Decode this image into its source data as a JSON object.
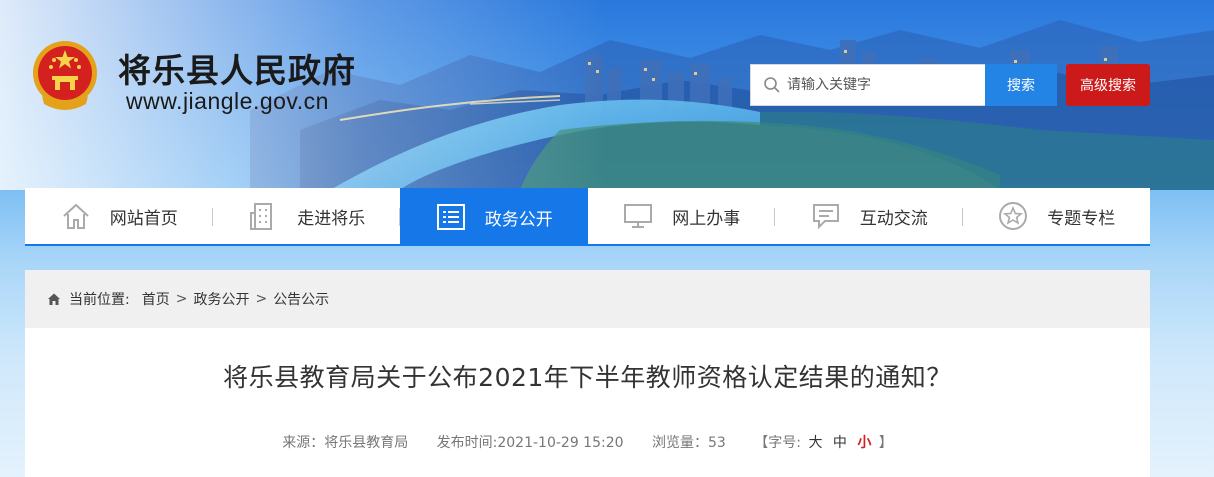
{
  "header": {
    "site_title": "将乐县人民政府",
    "site_url": "www.jiangle.gov.cn",
    "emblem_icon": "national-emblem-icon"
  },
  "search": {
    "placeholder": "请输入关键字",
    "value": "",
    "button_label": "搜索",
    "advanced_label": "高级搜索"
  },
  "nav": {
    "items": [
      {
        "label": "网站首页",
        "icon": "home-icon"
      },
      {
        "label": "走进将乐",
        "icon": "building-icon"
      },
      {
        "label": "政务公开",
        "icon": "list-icon"
      },
      {
        "label": "网上办事",
        "icon": "monitor-icon"
      },
      {
        "label": "互动交流",
        "icon": "chat-icon"
      },
      {
        "label": "专题专栏",
        "icon": "star-icon"
      }
    ]
  },
  "breadcrumb": {
    "prefix": "当前位置:",
    "items": [
      "首页",
      "政务公开",
      "公告公示"
    ],
    "separator": ">"
  },
  "article": {
    "title": "将乐县教育局关于公布2021年下半年教师资格认定结果的通知？",
    "source": "来源：将乐县教育局",
    "published": "发布时间:2021-10-29 15:20",
    "views": "浏览量：53",
    "fontsize_open": "【字号:",
    "fontsize_large": "大",
    "fontsize_medium": "中",
    "fontsize_small": "小",
    "fontsize_close": "】"
  },
  "colors": {
    "accent_blue": "#1677e8",
    "search_blue": "#2484e5",
    "advanced_red": "#cc1a1a",
    "selected_fontsize": "#d21f1f"
  }
}
